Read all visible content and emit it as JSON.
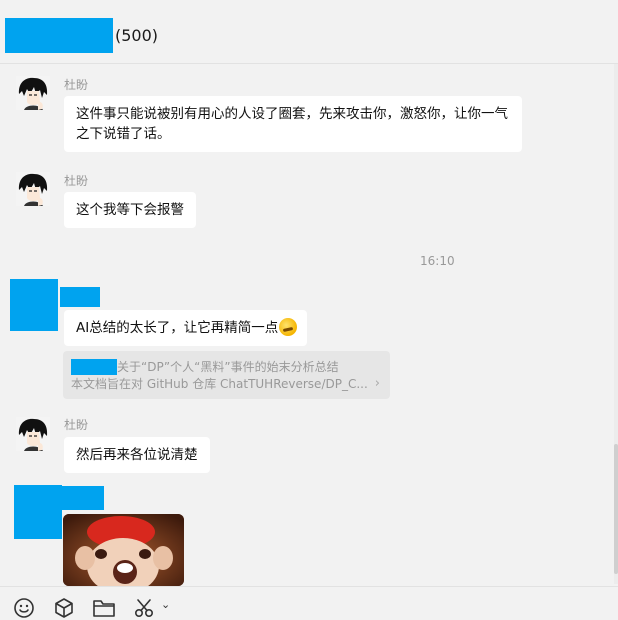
{
  "header": {
    "member_count": "(500)"
  },
  "messages": [
    {
      "sender": "杜盼",
      "text": "这件事只能说被别有用心的人设了圈套，先来攻击你，激怒你，让你一气之下说错了话。"
    },
    {
      "sender": "杜盼",
      "text": "这个我等下会报警"
    },
    {
      "text": "AI总结的太长了，让它再精简一点"
    },
    {
      "sender": "杜盼",
      "text": "然后再来各位说清楚"
    }
  ],
  "timestamp": "16:10",
  "quote": {
    "title": "关于“DP”个人“黑料”事件的始末分析总结",
    "body": "本文档旨在对 GitHub 仓库 ChatTUHReverse/DP_C...",
    "chevron": "›"
  },
  "toolbar": {
    "icons": [
      "emoji-icon",
      "cube-icon",
      "folder-icon",
      "scissors-icon",
      "chevron-down-icon"
    ],
    "caret": "⌄"
  },
  "colors": {
    "redaction": "#00a3ef",
    "background": "#f2f2f2",
    "bubble": "#ffffff"
  }
}
